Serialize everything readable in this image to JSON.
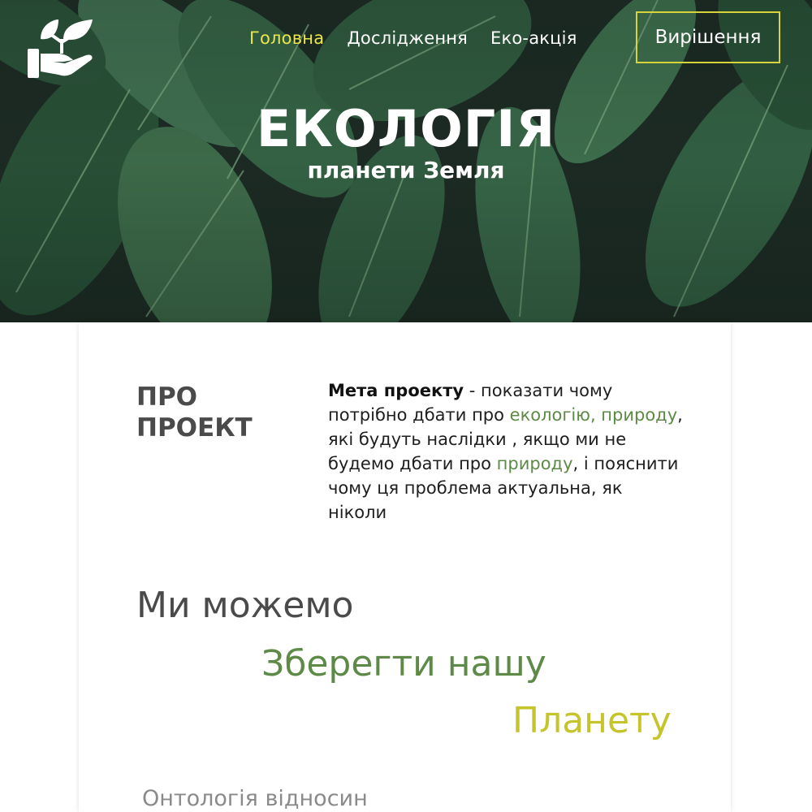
{
  "hero": {
    "title": "ЕКОЛОГІЯ",
    "subtitle": "планети Земля",
    "logo_icon": "leaf-hand-icon"
  },
  "nav": {
    "items": [
      {
        "label": "Головна",
        "active": true
      },
      {
        "label": "Дослідження",
        "active": false
      },
      {
        "label": "Еко-акція",
        "active": false
      }
    ],
    "cta_label": "Вирішення"
  },
  "about": {
    "title_line1": "ПРО",
    "title_line2": "ПРОЕКТ",
    "bold_lead": "Мета проекту",
    "text_part1": " - показати чому потрібно дбати про ",
    "highlight1": "екологію, природу",
    "text_part2": ", які будуть наслідки , якщо ми не будемо дбати про ",
    "highlight2": "природу",
    "text_part3": ", і пояснити чому ця проблема актуальна, як ніколи"
  },
  "slogan": {
    "line1": "Ми можемо",
    "line2": "Зберегти нашу",
    "line3": "Планету"
  },
  "next_section_title": "Онтологія відносин",
  "colors": {
    "accent_yellow": "#e8e64a",
    "accent_green": "#5d8a46",
    "accent_olive": "#c5c42a",
    "text_gray": "#4a4a4a"
  }
}
